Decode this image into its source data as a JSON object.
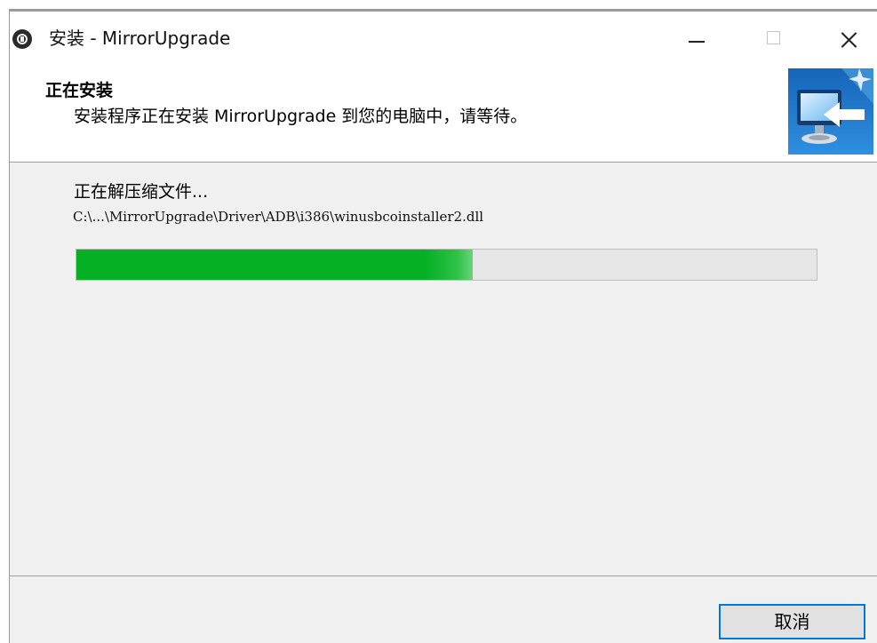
{
  "window": {
    "title": "安装 - MirrorUpgrade",
    "minimize_icon": "minimize-icon",
    "maximize_icon": "maximize-icon",
    "close_icon": "close-icon"
  },
  "header": {
    "title": "正在安装",
    "description": "安装程序正在安装 MirrorUpgrade 到您的电脑中，请等待。",
    "image_icon": "installer-computer-icon"
  },
  "content": {
    "status": "正在解压缩文件...",
    "current_file": "C:\\...\\MirrorUpgrade\\Driver\\ADB\\i386\\winusbcoinstaller2.dll",
    "progress_percent": 53.5,
    "progress_color": "#06b025"
  },
  "footer": {
    "cancel_label": "取消"
  }
}
